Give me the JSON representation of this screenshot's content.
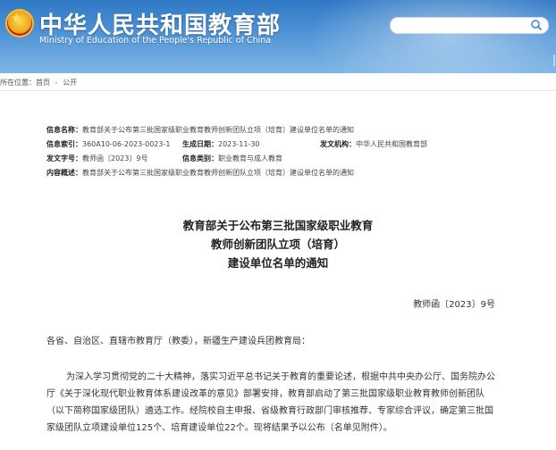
{
  "header": {
    "title": "中华人民共和国教育部",
    "subtitle": "Ministry of Education of the People's Republic of China",
    "colors": {
      "header_bg": "#3b82cc",
      "text": "#ffffff"
    }
  },
  "breadcrumb": [
    "所在位置：首页",
    "公开"
  ],
  "info": {
    "name_label": "信息名称：",
    "name_value": "教育部关于公布第三批国家级职业教育教师创新团队立项（培育）建设单位名单的通知",
    "index_label": "信息索引：",
    "index_value": "360A10-06-2023-0023-1",
    "date_label": "生成日期：",
    "date_value": "2023-11-30",
    "org_label": "发文机构：",
    "org_value": "中华人民共和国教育部",
    "docno_label": "发文字号：",
    "docno_value": "教师函〔2023〕9号",
    "category_label": "信息类别：",
    "category_value": "职业教育与成人教育",
    "summary_label": "内容概述：",
    "summary_value": "教育部关于公布第三批国家级职业教育教师创新团队立项（培育）建设单位名单的通知"
  },
  "document": {
    "title_line1": "教育部关于公布第三批国家级职业教育",
    "title_line2": "教师创新团队立项（培育）",
    "title_line3": "建设单位名单的通知",
    "number": "教师函〔2023〕9号",
    "salutation": "各省、自治区、直辖市教育厅（教委），新疆生产建设兵团教育局：",
    "para_line1": "为深入学习贯彻党的二十大精神，落实习近平总书记关于教育的重要论述，根据中共中央办公厅、国务院办公",
    "para_line2": "厅《关于深化现代职业教育体系建设改革的意见》部署安排，教育部启动了第三批国家级职业教育教师创新团队",
    "para_line3": "（以下简称国家级团队）遴选工作。经院校自主申报、省级教育行政部门审核推荐、专家综合评议，确定第三批国",
    "para_line4": "家级团队立项建设单位125个、培育建设单位22个。现将结果予以公布（名单见附件）。"
  }
}
